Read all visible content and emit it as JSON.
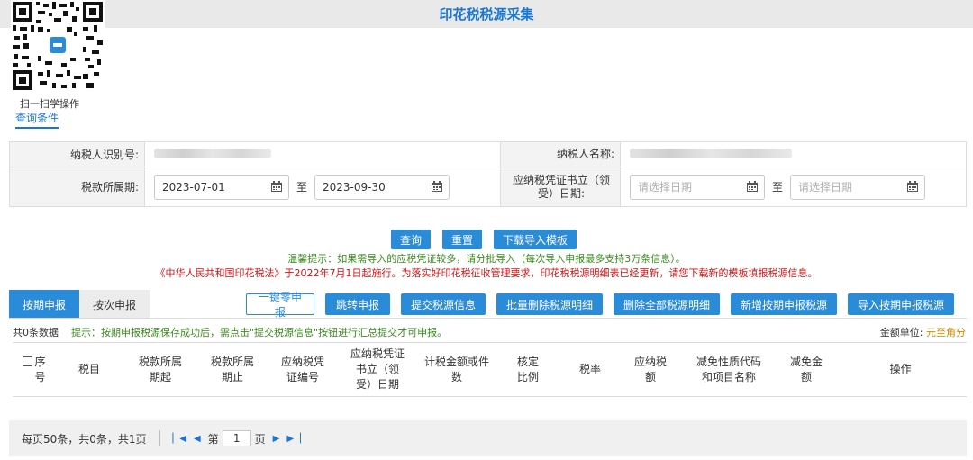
{
  "header": {
    "title": "印花税税源采集"
  },
  "qr": {
    "caption": "扫一扫学操作"
  },
  "query": {
    "section_label": "查询条件",
    "taxpayer_id_label": "纳税人识别号:",
    "taxpayer_name_label": "纳税人名称:",
    "period_label": "税款所属期:",
    "period_start": "2023-07-01",
    "period_end": "2023-09-30",
    "to_label": "至",
    "establish_date_label": "应纳税凭证书立（领受）日期:",
    "date_placeholder": "请选择日期"
  },
  "actions": {
    "search": "查询",
    "reset": "重置",
    "download_template": "下载导入模板"
  },
  "tips": {
    "tip1": "温馨提示：如果需导入的应税凭证较多，请分批导入（每次导入申报最多支持3万条信息）。",
    "tip2": "《中华人民共和国印花税法》于2022年7月1日起施行。为落实好印花税征收管理要求，印花税税源明细表已经更新，请您下载新的模板填报税源信息。"
  },
  "tabs": [
    {
      "label": "按期申报"
    },
    {
      "label": "按次申报"
    }
  ],
  "toolbar": [
    {
      "label": "一键零申报"
    },
    {
      "label": "跳转申报"
    },
    {
      "label": "提交税源信息"
    },
    {
      "label": "批量删除税源明细"
    },
    {
      "label": "删除全部税源明细"
    },
    {
      "label": "新增按期申报税源"
    },
    {
      "label": "导入按期申报税源"
    }
  ],
  "summary": {
    "count": "共0条数据",
    "hint": "提示：按期申报税源保存成功后，需点击\"提交税源信息\"按钮进行汇总提交才可申报。",
    "unit_label": "金额单位:",
    "unit_value": "元至角分"
  },
  "table": {
    "columns": [
      "序号",
      "税目",
      "税款所属期起",
      "税款所属期止",
      "应纳税凭证编号",
      "应纳税凭证书立（领受）日期",
      "计税金额或件数",
      "核定比例",
      "税率",
      "应纳税额",
      "减免性质代码和项目名称",
      "减免金额",
      "操作"
    ]
  },
  "pager": {
    "summary": "每页50条，共0条，共1页",
    "page_prefix": "第",
    "page_value": "1",
    "page_suffix": "页"
  }
}
